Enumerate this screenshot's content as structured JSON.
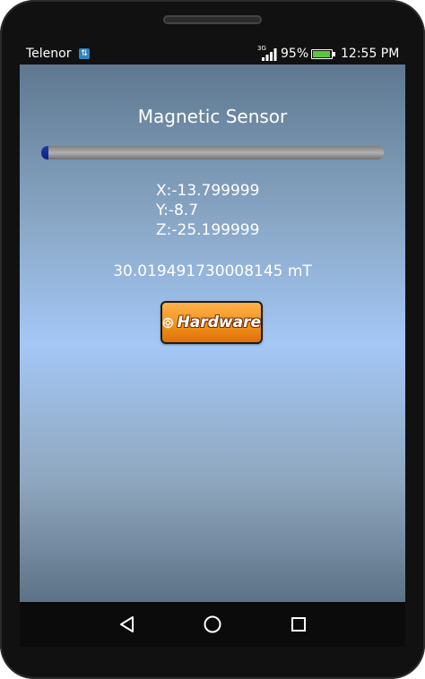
{
  "status_bar": {
    "carrier": "Telenor",
    "network_type": "3G",
    "battery_percent": "95%",
    "battery_level": 0.95,
    "time": "12:55 PM",
    "icons": [
      "carrier-sim-icon",
      "signal-icon",
      "battery-icon"
    ]
  },
  "app": {
    "title": "Magnetic Sensor",
    "progress": 0.02,
    "readings": {
      "x": "X:-13.799999",
      "y": "Y:-8.7",
      "z": "Z:-25.199999"
    },
    "magnitude": "30.019491730008145 mT",
    "hardware_button_label": "Hardware"
  },
  "nav_bar": {
    "icons": [
      "back-icon",
      "home-icon",
      "recent-apps-icon"
    ]
  },
  "colors": {
    "progress_fill": "#0a1f88",
    "button_orange": "#f08f1b",
    "screen_top": "#5e788f",
    "screen_mid": "#a4c7f6"
  }
}
